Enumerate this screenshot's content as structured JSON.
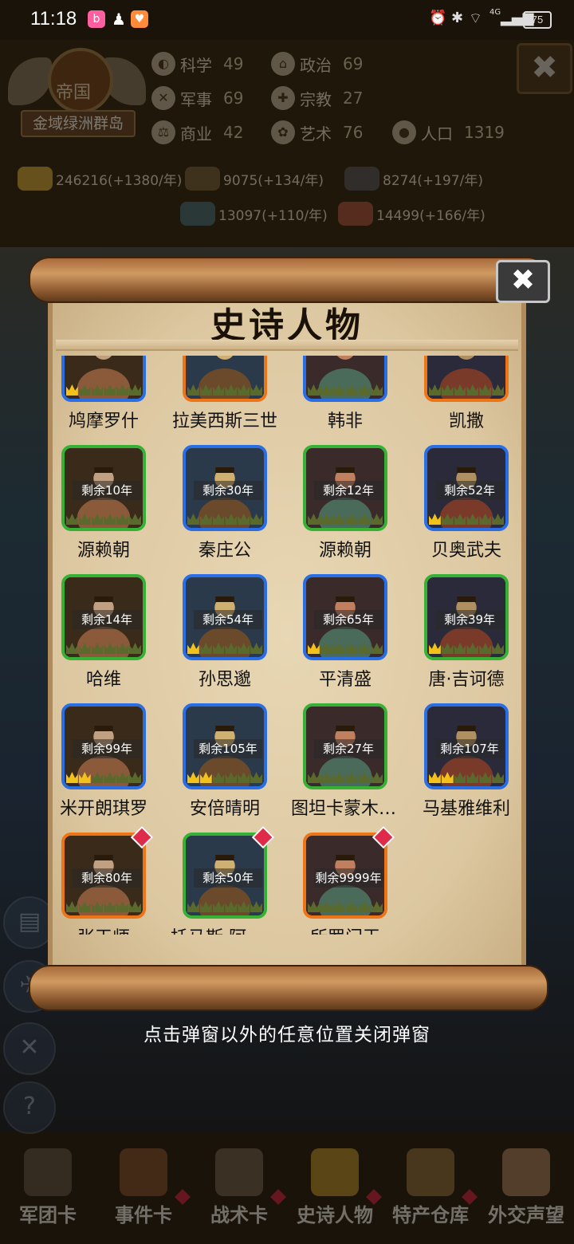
{
  "status_bar": {
    "time": "11:18",
    "network": "4G",
    "battery": "75",
    "app_icons": [
      "bilibili",
      "qq",
      "huya"
    ]
  },
  "background": {
    "empire_title": "帝国",
    "empire_name": "金域绿洲群岛",
    "stats": [
      {
        "label": "科学",
        "value": "49",
        "icon": "planet-icon"
      },
      {
        "label": "政治",
        "value": "69",
        "icon": "temple-icon"
      },
      {
        "label": "军事",
        "value": "69",
        "icon": "swords-icon"
      },
      {
        "label": "宗教",
        "value": "27",
        "icon": "cross-icon"
      },
      {
        "label": "商业",
        "value": "42",
        "icon": "scale-icon"
      },
      {
        "label": "艺术",
        "value": "76",
        "icon": "art-icon"
      },
      {
        "label": "人口",
        "value": "1319",
        "icon": "person-icon"
      }
    ],
    "resources": [
      "246216(+1380/年)",
      "9075(+134/年)",
      "8274(+197/年)",
      "13097(+110/年)",
      "14499(+166/年)"
    ],
    "bottom_nav": [
      {
        "label": "军团卡",
        "dot": false
      },
      {
        "label": "事件卡",
        "dot": true
      },
      {
        "label": "战术卡",
        "dot": true
      },
      {
        "label": "史诗人物",
        "dot": true
      },
      {
        "label": "特产仓库",
        "dot": true
      },
      {
        "label": "外交声望",
        "dot": false
      }
    ]
  },
  "modal": {
    "title": "史诗人物",
    "close_label": "✖",
    "hint": "点击弹窗以外的任意位置关闭弹窗",
    "characters": [
      {
        "name": "鸠摩罗什",
        "remaining": "",
        "tier": "blue",
        "crowns": 1,
        "new": false
      },
      {
        "name": "拉美西斯三世",
        "remaining": "",
        "tier": "orange",
        "crowns": 0,
        "new": false
      },
      {
        "name": "韩非",
        "remaining": "",
        "tier": "blue",
        "crowns": 0,
        "new": false
      },
      {
        "name": "凯撒",
        "remaining": "",
        "tier": "orange",
        "crowns": 0,
        "new": false
      },
      {
        "name": "源赖朝",
        "remaining": "剩余10年",
        "tier": "green",
        "crowns": 0,
        "new": false
      },
      {
        "name": "秦庄公",
        "remaining": "剩余30年",
        "tier": "blue",
        "crowns": 0,
        "new": false
      },
      {
        "name": "源赖朝",
        "remaining": "剩余12年",
        "tier": "green",
        "crowns": 0,
        "new": false
      },
      {
        "name": "贝奥武夫",
        "remaining": "剩余52年",
        "tier": "blue",
        "crowns": 1,
        "new": false
      },
      {
        "name": "哈维",
        "remaining": "剩余14年",
        "tier": "green",
        "crowns": 0,
        "new": false
      },
      {
        "name": "孙思邈",
        "remaining": "剩余54年",
        "tier": "blue",
        "crowns": 1,
        "new": false
      },
      {
        "name": "平清盛",
        "remaining": "剩余65年",
        "tier": "blue",
        "crowns": 1,
        "new": false
      },
      {
        "name": "唐·吉诃德",
        "remaining": "剩余39年",
        "tier": "green",
        "crowns": 1,
        "new": false
      },
      {
        "name": "米开朗琪罗",
        "remaining": "剩余99年",
        "tier": "blue",
        "crowns": 2,
        "new": false
      },
      {
        "name": "安倍晴明",
        "remaining": "剩余105年",
        "tier": "blue",
        "crowns": 2,
        "new": false
      },
      {
        "name": "图坦卡蒙木乃伊",
        "remaining": "剩余27年",
        "tier": "green",
        "crowns": 0,
        "new": false
      },
      {
        "name": "马基雅维利",
        "remaining": "剩余107年",
        "tier": "blue",
        "crowns": 2,
        "new": false
      },
      {
        "name": "张天师",
        "remaining": "剩余80年",
        "tier": "orange",
        "crowns": 0,
        "new": true
      },
      {
        "name": "托马斯·阿奎那",
        "remaining": "剩余50年",
        "tier": "green",
        "crowns": 0,
        "new": true
      },
      {
        "name": "所罗门王",
        "remaining": "剩余9999年",
        "tier": "orange",
        "crowns": 0,
        "new": true
      }
    ]
  }
}
